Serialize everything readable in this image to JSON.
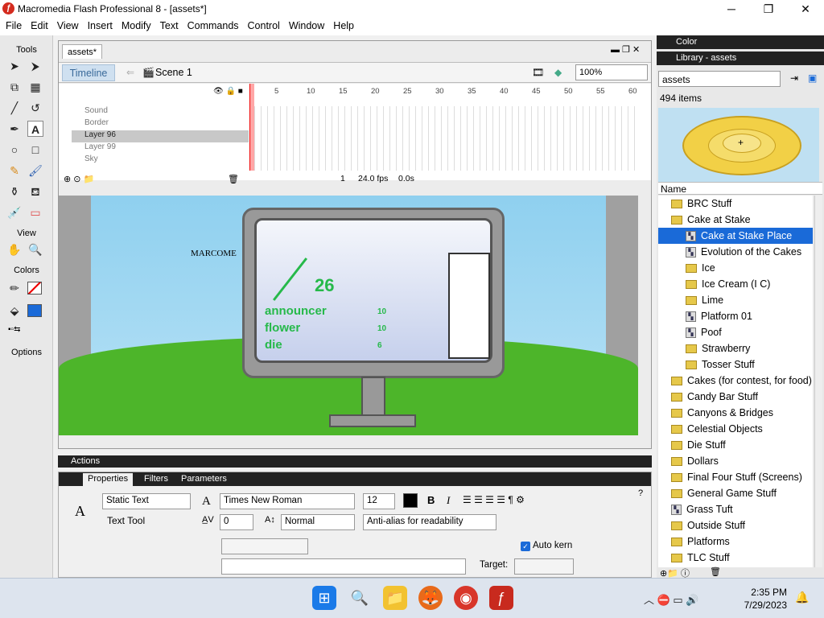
{
  "window": {
    "title": "Macromedia Flash Professional 8 - [assets*]",
    "minimize": "─",
    "restore": "❐",
    "close": "✕"
  },
  "menu": [
    "File",
    "Edit",
    "View",
    "Insert",
    "Modify",
    "Text",
    "Commands",
    "Control",
    "Window",
    "Help"
  ],
  "tools": {
    "title": "Tools",
    "view_title": "View",
    "colors_title": "Colors",
    "options_title": "Options"
  },
  "document": {
    "tab": "assets*",
    "timeline_button": "Timeline",
    "scene": "Scene 1",
    "zoom": "100%",
    "layers": [
      "Sound",
      "Border",
      "Layer 96",
      "Layer 99",
      "Sky"
    ],
    "ruler": [
      "5",
      "10",
      "15",
      "20",
      "25",
      "30",
      "35",
      "40",
      "45",
      "50",
      "55",
      "60"
    ],
    "frame": "1",
    "fps": "24.0 fps",
    "time": "0.0s"
  },
  "stage": {
    "marco": "MARCOME",
    "num": "26",
    "words": [
      "announcer",
      "flower",
      "die"
    ],
    "small": [
      "10",
      "10",
      "6"
    ]
  },
  "actions": {
    "title": "Actions"
  },
  "properties": {
    "tabs": [
      "Properties",
      "Filters",
      "Parameters"
    ],
    "text_type": "Static Text",
    "tool": "Text Tool",
    "font": "Times New Roman",
    "size": "12",
    "spacing": "0",
    "position": "Normal",
    "antialias": "Anti-alias for readability",
    "auto_kern": "Auto kern",
    "target": "Target:"
  },
  "panels": {
    "color": "Color",
    "library": "Library - assets"
  },
  "library": {
    "doc": "assets",
    "count": "494 items",
    "col": "Name",
    "items": [
      {
        "label": "BRC Stuff",
        "t": "fold",
        "i": 1
      },
      {
        "label": "Cake at Stake",
        "t": "fold",
        "i": 1
      },
      {
        "label": "Cake at Stake Place",
        "t": "sym",
        "i": 2,
        "sel": true
      },
      {
        "label": "Evolution of the Cakes",
        "t": "sym",
        "i": 2
      },
      {
        "label": "Ice",
        "t": "fold",
        "i": 2
      },
      {
        "label": "Ice Cream (I C)",
        "t": "fold",
        "i": 2
      },
      {
        "label": "Lime",
        "t": "fold",
        "i": 2
      },
      {
        "label": "Platform 01",
        "t": "sym",
        "i": 2
      },
      {
        "label": "Poof",
        "t": "sym",
        "i": 2
      },
      {
        "label": "Strawberry",
        "t": "fold",
        "i": 2
      },
      {
        "label": "Tosser Stuff",
        "t": "fold",
        "i": 2
      },
      {
        "label": "Cakes (for contest, for food)",
        "t": "fold",
        "i": 1
      },
      {
        "label": "Candy Bar Stuff",
        "t": "fold",
        "i": 1
      },
      {
        "label": "Canyons & Bridges",
        "t": "fold",
        "i": 1
      },
      {
        "label": "Celestial Objects",
        "t": "fold",
        "i": 1
      },
      {
        "label": "Die Stuff",
        "t": "fold",
        "i": 1
      },
      {
        "label": "Dollars",
        "t": "fold",
        "i": 1
      },
      {
        "label": "Final Four Stuff (Screens)",
        "t": "fold",
        "i": 1
      },
      {
        "label": "General Game Stuff",
        "t": "fold",
        "i": 1
      },
      {
        "label": "Grass Tuft",
        "t": "sym",
        "i": 1
      },
      {
        "label": "Outside Stuff",
        "t": "fold",
        "i": 1
      },
      {
        "label": "Platforms",
        "t": "fold",
        "i": 1
      },
      {
        "label": "TLC Stuff",
        "t": "fold",
        "i": 1
      }
    ]
  },
  "taskbar": {
    "time": "2:35 PM",
    "date": "7/29/2023"
  }
}
